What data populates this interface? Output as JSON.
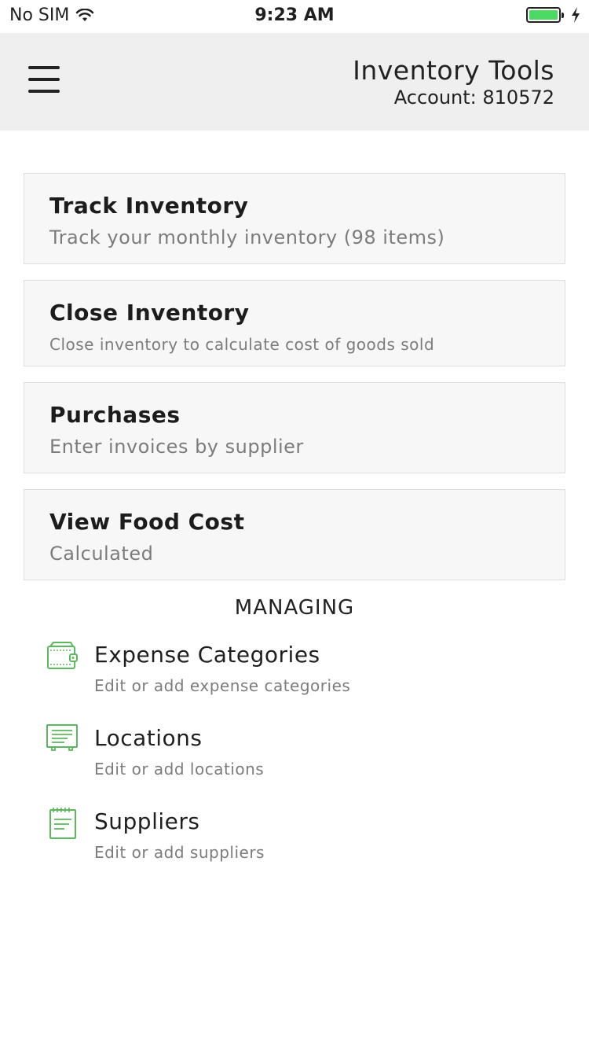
{
  "status_bar": {
    "carrier": "No SIM",
    "time": "9:23 AM",
    "battery_color": "#4cd964"
  },
  "header": {
    "title": "Inventory Tools",
    "account": "Account: 810572",
    "menu_icon": "hamburger-icon",
    "background": "#efefef"
  },
  "cards": [
    {
      "title": "Track Inventory",
      "subtitle": "Track your monthly inventory (98 items)"
    },
    {
      "title": "Close Inventory",
      "subtitle": "Close inventory to calculate cost of goods sold"
    },
    {
      "title": "Purchases",
      "subtitle": "Enter invoices by supplier"
    },
    {
      "title": "View Food Cost",
      "subtitle": "Calculated"
    }
  ],
  "managing": {
    "header": "MANAGING",
    "accent_color": "#5cb85c",
    "items": [
      {
        "title": "Expense Categories",
        "subtitle": "Edit or add expense categories",
        "icon": "wallet-icon"
      },
      {
        "title": "Locations",
        "subtitle": "Edit or add locations",
        "icon": "receipt-icon"
      },
      {
        "title": "Suppliers",
        "subtitle": "Edit or add suppliers",
        "icon": "notepad-icon"
      }
    ]
  }
}
